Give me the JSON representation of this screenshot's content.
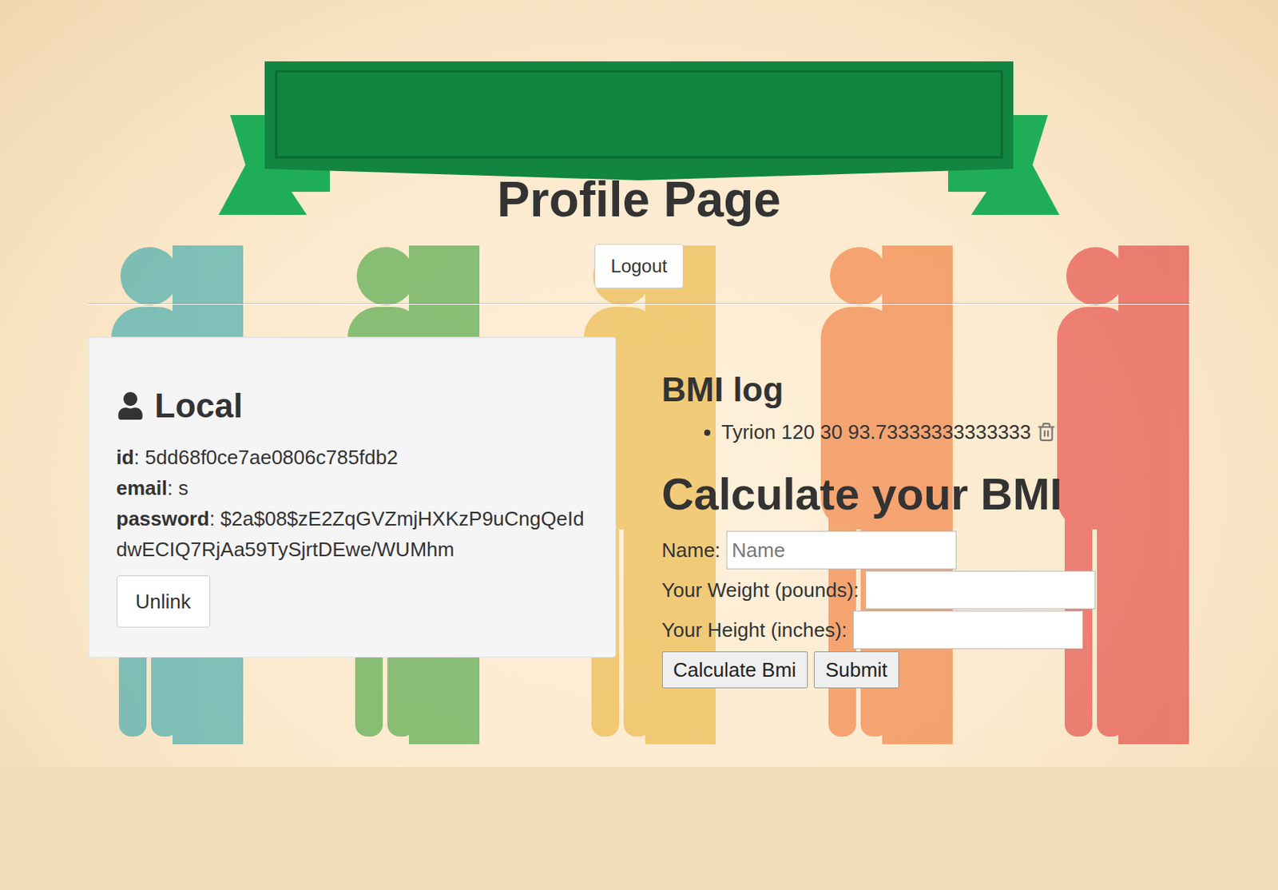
{
  "page": {
    "title": "Profile Page"
  },
  "logout_button": "Logout",
  "local_card": {
    "heading": "Local",
    "fields": [
      {
        "label": "id",
        "separator": ":",
        "value": "5dd68f0ce7ae0806c785fdb2"
      },
      {
        "label": "email",
        "separator": ":",
        "value": "s"
      },
      {
        "label": "password",
        "separator": ":",
        "value": "$2a$08$zE2ZqGVZmjHXKzP9uCngQeIddwECIQ7RjAa59TySjrtDEwe/WUMhm"
      }
    ],
    "unlink_button": "Unlink"
  },
  "bmi_log": {
    "title": "BMI log",
    "entries": [
      {
        "name": "Tyrion",
        "weight": "120",
        "height": "30",
        "bmi": "93.73333333333333"
      }
    ]
  },
  "calculator": {
    "title": "Calculate your BMI",
    "fields": [
      {
        "label": "Name:",
        "placeholder": "Name"
      },
      {
        "label": "Your Weight (pounds):",
        "placeholder": ""
      },
      {
        "label": "Your Height (inches):",
        "placeholder": ""
      }
    ],
    "buttons": [
      "Calculate Bmi",
      "Submit"
    ]
  }
}
